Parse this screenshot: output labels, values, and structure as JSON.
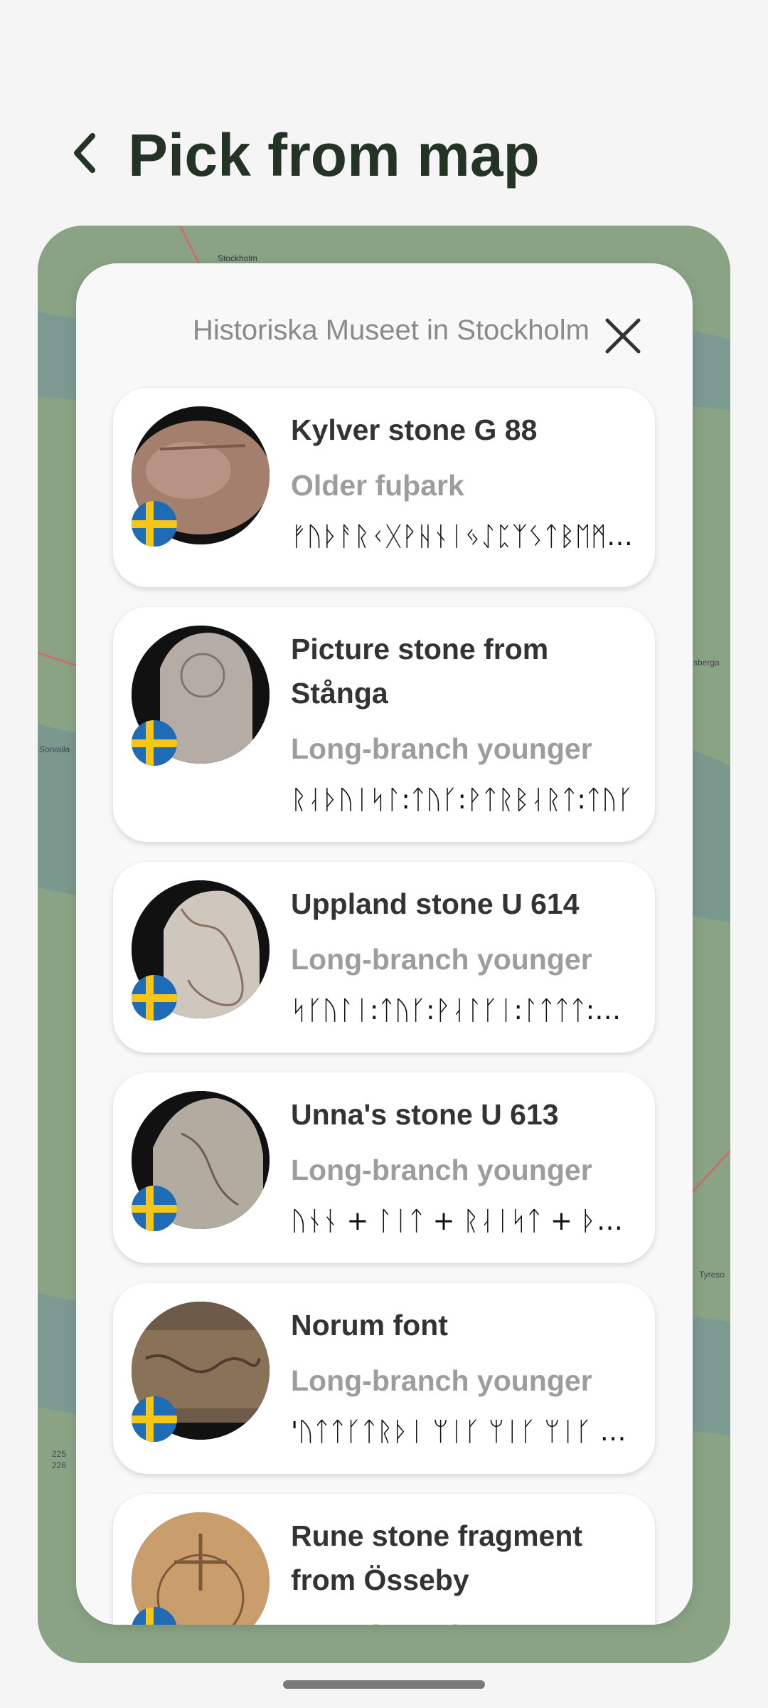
{
  "header": {
    "title": "Pick from map",
    "back_icon": "chevron-left-icon"
  },
  "map": {
    "labels": [
      "Stockholm",
      "Sorvalla",
      "sberga",
      "Tyreso",
      "225",
      "226"
    ]
  },
  "modal": {
    "location_title": "Historiska Museet in Stockholm",
    "close_icon": "close-icon"
  },
  "stones": [
    {
      "name": "Kylver stone G 88",
      "script": "Older fuþark",
      "runes": "ᚠᚢᚦᚨᚱᚲᚷᚹᚺᚾᛁᛃᛇᛈᛉᛊᛏᛒᛖᛗᛚᛜᛞᛟ",
      "flag": "sweden-flag-icon"
    },
    {
      "name": "Picture stone from Stånga",
      "script": "Long-branch younger",
      "runes": "ᚱᛆᚦᚢᛁᛋᛚ:ᛏᚢᚴ:ᚹᛏᚱᛒᛆᚱᛏ:ᛏᚢᚴ",
      "flag": "sweden-flag-icon"
    },
    {
      "name": "Uppland stone U 614",
      "script": "Long-branch younger",
      "runes": "ᛋᚴᚢᛚᛁ:ᛏᚢᚴ:ᚹᛆᛚᚴᛁ:ᛚᛏᛏᛏ:ᚱᛆᛁᛋᛏᛆ",
      "flag": "sweden-flag-icon"
    },
    {
      "name": "Unna's stone U 613",
      "script": "Long-branch younger",
      "runes": "ᚢᚾᚾ + ᛚᛁᛏ + ᚱᛆᛁᛋᛏ + ᚦᛁᚾᛋᛏ",
      "flag": "sweden-flag-icon"
    },
    {
      "name": "Norum font",
      "script": "Long-branch younger",
      "runes": "'ᚢᛏᛏᚴᛏᚱᚦᛁ ᛘᛁᚴ ᛘᛁᚴ ᛘᛁᚴ ᛘᛁᚴ",
      "flag": "sweden-flag-icon"
    },
    {
      "name": "Rune stone fragment from Össeby",
      "script": "Long-branch younger",
      "runes": "",
      "flag": "sweden-flag-icon"
    }
  ],
  "colors": {
    "title": "#233424",
    "map_green": "#86a080",
    "card_bg": "#ffffff",
    "muted_text": "#9d9d9d",
    "flag_blue": "#1f6bb5",
    "flag_yellow": "#f5c518"
  }
}
